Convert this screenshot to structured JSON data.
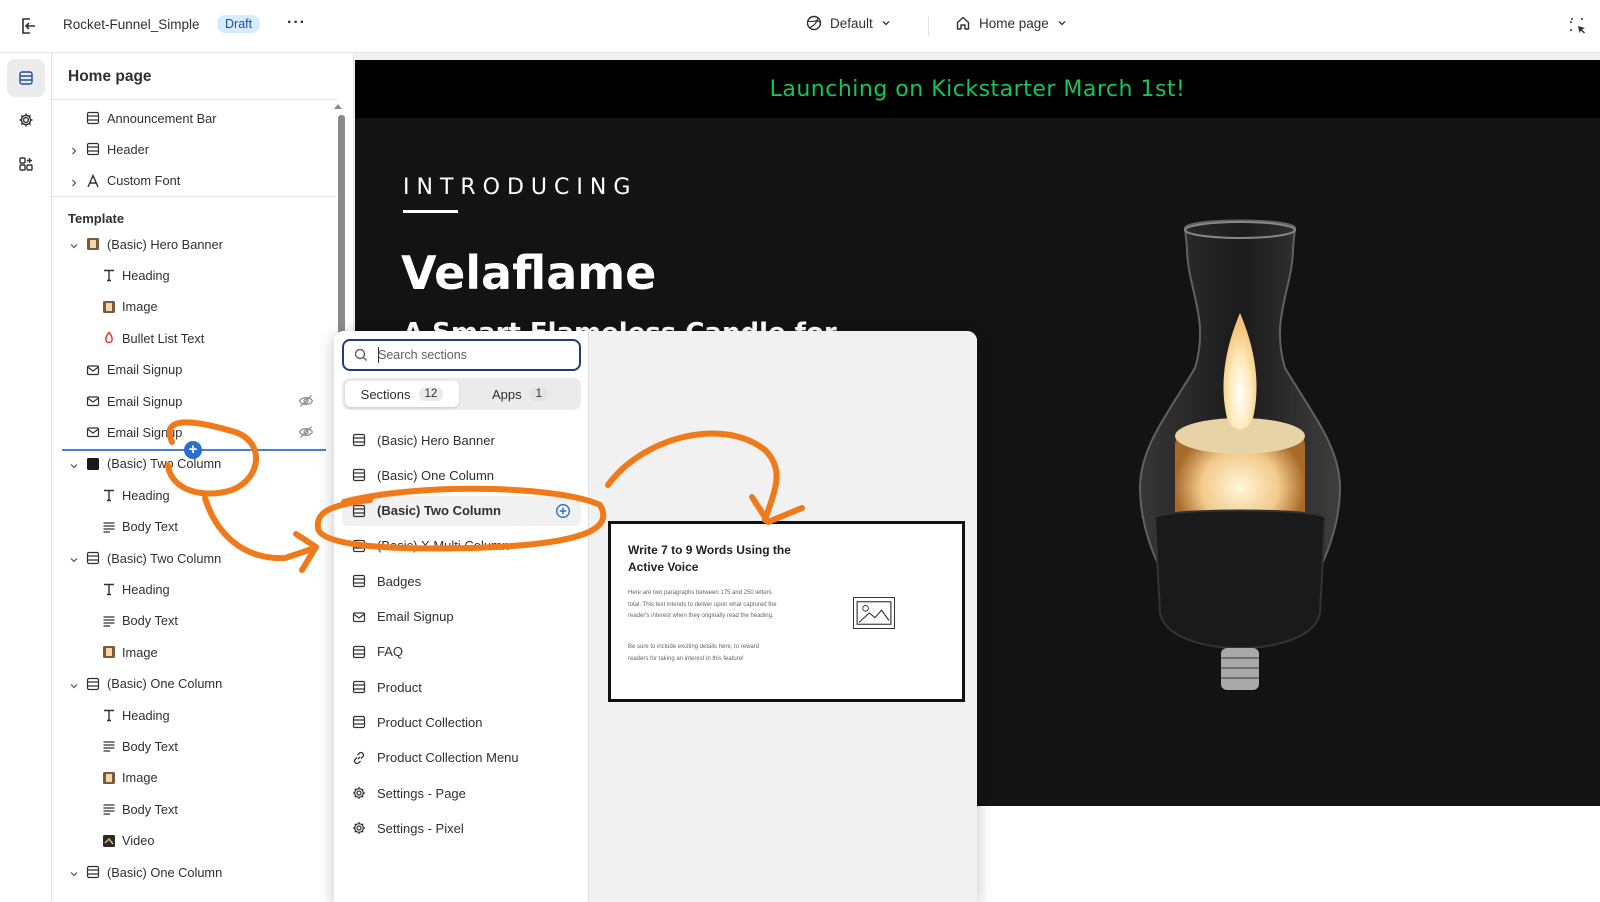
{
  "topbar": {
    "store_name": "Rocket-Funnel_Simple",
    "status_badge": "Draft",
    "more_label": "···",
    "theme_selector": "Default",
    "page_selector": "Home page"
  },
  "sidebar": {
    "title": "Home page",
    "header_group": [
      {
        "label": "Announcement Bar",
        "icon": "section-icon",
        "expandable": false
      },
      {
        "label": "Header",
        "icon": "section-icon",
        "expandable": true
      },
      {
        "label": "Custom Font",
        "icon": "font-icon",
        "expandable": true
      }
    ],
    "template_label": "Template",
    "template_items": [
      {
        "label": "(Basic) Hero Banner",
        "level": 0,
        "expanded": true,
        "icon": "image-thumb-icon"
      },
      {
        "label": "Heading",
        "level": 1,
        "icon": "text-icon"
      },
      {
        "label": "Image",
        "level": 1,
        "icon": "image-thumb-icon"
      },
      {
        "label": "Bullet List Text",
        "level": 1,
        "icon": "flame-icon"
      },
      {
        "label": "Email Signup",
        "level": 0,
        "icon": "email-icon"
      },
      {
        "label": "Email Signup",
        "level": 0,
        "icon": "email-icon",
        "hidden": true
      },
      {
        "label": "Email Signup",
        "level": 0,
        "icon": "email-icon",
        "hidden": true
      },
      {
        "label": "(Basic) Two Column",
        "level": 0,
        "expanded": true,
        "icon": "dark-thumb-icon"
      },
      {
        "label": "Heading",
        "level": 1,
        "icon": "text-icon"
      },
      {
        "label": "Body Text",
        "level": 1,
        "icon": "paragraph-icon"
      },
      {
        "label": "(Basic) Two Column",
        "level": 0,
        "expanded": true,
        "icon": "section-icon"
      },
      {
        "label": "Heading",
        "level": 1,
        "icon": "text-icon"
      },
      {
        "label": "Body Text",
        "level": 1,
        "icon": "paragraph-icon"
      },
      {
        "label": "Image",
        "level": 1,
        "icon": "image-thumb-icon"
      },
      {
        "label": "(Basic) One Column",
        "level": 0,
        "expanded": true,
        "icon": "section-icon"
      },
      {
        "label": "Heading",
        "level": 1,
        "icon": "text-icon"
      },
      {
        "label": "Body Text",
        "level": 1,
        "icon": "paragraph-icon"
      },
      {
        "label": "Image",
        "level": 1,
        "icon": "image-thumb-icon"
      },
      {
        "label": "Body Text",
        "level": 1,
        "icon": "paragraph-icon"
      },
      {
        "label": "Video",
        "level": 1,
        "icon": "video-thumb-icon"
      },
      {
        "label": "(Basic) One Column",
        "level": 0,
        "expanded": true,
        "icon": "section-icon"
      }
    ]
  },
  "picker": {
    "search_placeholder": "Search sections",
    "tabs": [
      {
        "label": "Sections",
        "count": "12",
        "active": true
      },
      {
        "label": "Apps",
        "count": "1",
        "active": false
      }
    ],
    "items": [
      {
        "label": "(Basic) Hero Banner",
        "icon": "section-icon"
      },
      {
        "label": "(Basic) One Column",
        "icon": "section-icon"
      },
      {
        "label": "(Basic) Two Column",
        "icon": "section-icon",
        "highlighted": true
      },
      {
        "label": "(Basic) X Multi Column",
        "icon": "section-icon"
      },
      {
        "label": "Badges",
        "icon": "section-icon"
      },
      {
        "label": "Email Signup",
        "icon": "email-icon"
      },
      {
        "label": "FAQ",
        "icon": "section-icon"
      },
      {
        "label": "Product",
        "icon": "section-icon"
      },
      {
        "label": "Product Collection",
        "icon": "section-icon"
      },
      {
        "label": "Product Collection Menu",
        "icon": "link-icon"
      },
      {
        "label": "Settings - Page",
        "icon": "gear-icon"
      },
      {
        "label": "Settings - Pixel",
        "icon": "gear-icon"
      }
    ],
    "preview": {
      "title": "Write 7 to 9 Words Using the Active Voice",
      "paragraph_1": "Here are two paragraphs between 175 and 250 letters total. This text intends to deliver upon what captured the reader's interest when they originally read the heading.",
      "paragraph_2": "Be sure to include exciting details here, to reward readers for taking an interest in this feature!"
    }
  },
  "preview": {
    "announcement": "Launching on Kickstarter March 1st!",
    "eyebrow": "INTRODUCING",
    "title": "Velaflame",
    "subtitle": "A Smart Flameless Candle for"
  },
  "colors": {
    "accent_blue": "#2c6ecb",
    "announcement_green": "#17c45a",
    "annotation_orange": "#f07a1a"
  }
}
